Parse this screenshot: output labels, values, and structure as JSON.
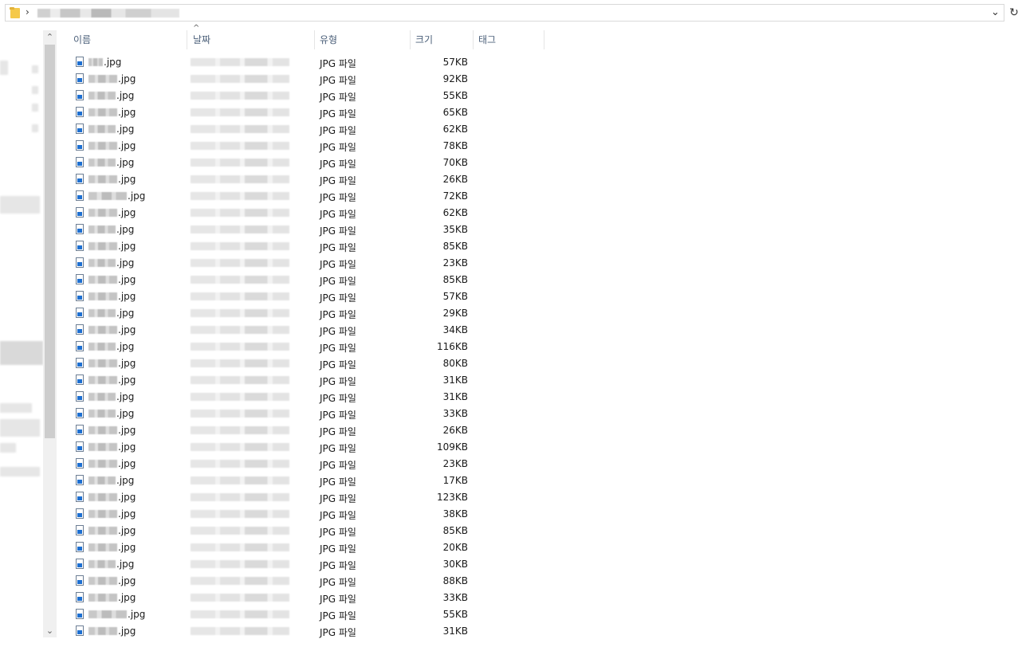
{
  "address_bar": {
    "separator": "›",
    "dropdown_glyph": "⌄",
    "refresh_glyph": "↻"
  },
  "columns": [
    {
      "label": "이름"
    },
    {
      "label": "날짜"
    },
    {
      "label": "유형"
    },
    {
      "label": "크기"
    },
    {
      "label": "태그"
    }
  ],
  "scrollbar": {
    "up_glyph": "⌃",
    "down_glyph": "⌄"
  },
  "file_type_label": "JPG 파일",
  "files": [
    {
      "ext": ".jpg",
      "size": "57KB"
    },
    {
      "ext": ".jpg",
      "size": "92KB"
    },
    {
      "ext": ".jpg",
      "size": "55KB"
    },
    {
      "ext": ".jpg",
      "size": "65KB"
    },
    {
      "ext": ".jpg",
      "size": "62KB"
    },
    {
      "ext": ".jpg",
      "size": "78KB"
    },
    {
      "ext": ".jpg",
      "size": "70KB"
    },
    {
      "ext": ".jpg",
      "size": "26KB"
    },
    {
      "ext": ".jpg",
      "size": "72KB"
    },
    {
      "ext": ".jpg",
      "size": "62KB"
    },
    {
      "ext": ".jpg",
      "size": "35KB"
    },
    {
      "ext": ".jpg",
      "size": "85KB"
    },
    {
      "ext": ".jpg",
      "size": "23KB"
    },
    {
      "ext": ".jpg",
      "size": "85KB"
    },
    {
      "ext": ".jpg",
      "size": "57KB"
    },
    {
      "ext": ".jpg",
      "size": "29KB"
    },
    {
      "ext": ".jpg",
      "size": "34KB"
    },
    {
      "ext": ".jpg",
      "size": "116KB"
    },
    {
      "ext": ".jpg",
      "size": "80KB"
    },
    {
      "ext": ".jpg",
      "size": "31KB"
    },
    {
      "ext": ".jpg",
      "size": "31KB"
    },
    {
      "ext": ".jpg",
      "size": "33KB"
    },
    {
      "ext": ".jpg",
      "size": "26KB"
    },
    {
      "ext": ".jpg",
      "size": "109KB"
    },
    {
      "ext": ".jpg",
      "size": "23KB"
    },
    {
      "ext": ".jpg",
      "size": "17KB"
    },
    {
      "ext": ".jpg",
      "size": "123KB"
    },
    {
      "ext": ".jpg",
      "size": "38KB"
    },
    {
      "ext": ".jpg",
      "size": "85KB"
    },
    {
      "ext": ".jpg",
      "size": "20KB"
    },
    {
      "ext": ".jpg",
      "size": "30KB"
    },
    {
      "ext": ".jpg",
      "size": "88KB"
    },
    {
      "ext": ".jpg",
      "size": "33KB"
    },
    {
      "ext": ".jpg",
      "size": "55KB"
    },
    {
      "ext": ".jpg",
      "size": "31KB"
    }
  ]
}
